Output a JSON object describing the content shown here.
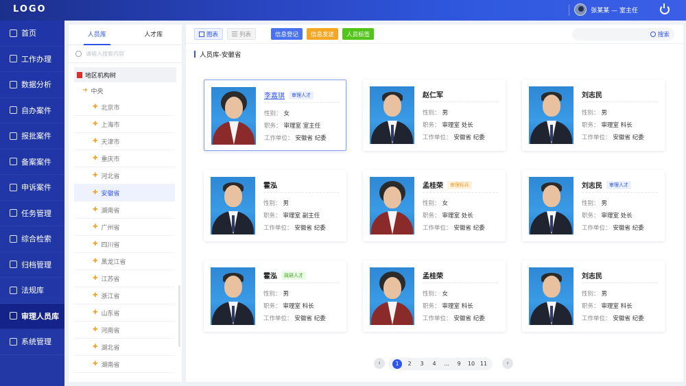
{
  "header": {
    "logo": "LOGO",
    "user": "张某某 — 室主任"
  },
  "sidebar": {
    "items": [
      {
        "label": "首页",
        "icon": "home-icon"
      },
      {
        "label": "工作办理",
        "icon": "briefcase-icon"
      },
      {
        "label": "数据分析",
        "icon": "chart-icon"
      },
      {
        "label": "自办案件",
        "icon": "clipboard-icon"
      },
      {
        "label": "报批案件",
        "icon": "edit-doc-icon"
      },
      {
        "label": "备案案件",
        "icon": "archive-doc-icon"
      },
      {
        "label": "申诉案件",
        "icon": "appeal-icon"
      },
      {
        "label": "任务管理",
        "icon": "calendar-icon"
      },
      {
        "label": "综合检索",
        "icon": "grid-icon"
      },
      {
        "label": "归档管理",
        "icon": "folder-icon"
      },
      {
        "label": "法规库",
        "icon": "scale-icon"
      },
      {
        "label": "审理人员库",
        "icon": "people-icon",
        "active": true
      },
      {
        "label": "系统管理",
        "icon": "settings-icon"
      }
    ]
  },
  "tree": {
    "tabs": [
      "人员库",
      "人才库"
    ],
    "search_placeholder": "请输入搜索内容",
    "root": "地区机构树",
    "center": "中央",
    "nodes": [
      "北京市",
      "上海市",
      "天津市",
      "重庆市",
      "河北省",
      "安徽省",
      "湖南省",
      "广州省",
      "四川省",
      "黑龙江省",
      "江苏省",
      "浙江省",
      "山东省",
      "河南省",
      "湖北省",
      "湖南省"
    ],
    "active_index": 5
  },
  "toolbar": {
    "view_grid": "图表",
    "view_list": "列表",
    "btn_register": "信息登记",
    "btn_send": "信息发送",
    "btn_tag": "人员标签",
    "search": "搜索",
    "colors": {
      "blue": "#4a72ee",
      "orange": "#f5a623",
      "green": "#52c41a"
    }
  },
  "section_title": "人员库-安徽省",
  "labels": {
    "gender": "性别：",
    "position": "职务：",
    "unit": "工作单位："
  },
  "cards": [
    {
      "name": "李嘉琪",
      "tag": "审理人才",
      "tag_color": "blue",
      "gender": "女",
      "position": "审理室 室主任",
      "unit": "安徽省 纪委",
      "female": true,
      "selected": true,
      "link": true
    },
    {
      "name": "赵仁军",
      "tag": "",
      "tag_color": "",
      "gender": "男",
      "position": "审理室 处长",
      "unit": "安徽省 纪委"
    },
    {
      "name": "刘志民",
      "tag": "",
      "tag_color": "",
      "gender": "男",
      "position": "审理室 科长",
      "unit": "安徽省 纪委"
    },
    {
      "name": "霍泓",
      "tag": "",
      "tag_color": "",
      "gender": "男",
      "position": "审理室 副主任",
      "unit": "安徽省 纪委"
    },
    {
      "name": "孟桂荣",
      "tag": "审理标兵",
      "tag_color": "orange",
      "gender": "女",
      "position": "审理室 处长",
      "unit": "安徽省 纪委",
      "female": true
    },
    {
      "name": "刘志民",
      "tag": "审理人才",
      "tag_color": "blue",
      "gender": "男",
      "position": "审理室 处长",
      "unit": "安徽省 纪委"
    },
    {
      "name": "霍泓",
      "tag": "政研人才",
      "tag_color": "green",
      "gender": "男",
      "position": "审理室 科长",
      "unit": "安徽省 纪委"
    },
    {
      "name": "孟桂荣",
      "tag": "",
      "tag_color": "",
      "gender": "女",
      "position": "审理室 科长",
      "unit": "安徽省 纪委",
      "female": true
    },
    {
      "name": "刘志民",
      "tag": "",
      "tag_color": "",
      "gender": "男",
      "position": "审理室 科长",
      "unit": "安徽省 纪委"
    }
  ],
  "pagination": {
    "pages": [
      "1",
      "2",
      "3",
      "4",
      "...",
      "9",
      "10",
      "11"
    ],
    "current": "1",
    "prev": "‹",
    "next": "›"
  }
}
